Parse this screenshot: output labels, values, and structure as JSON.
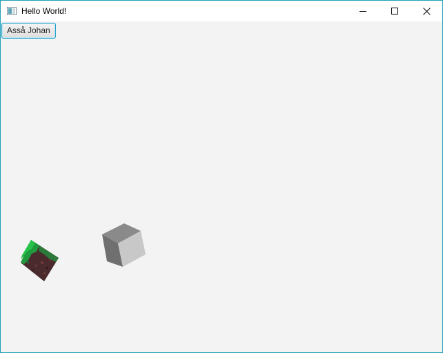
{
  "window": {
    "title": "Hello World!",
    "app_icon": "java-app-icon",
    "controls": {
      "minimize_icon": "minimize-icon",
      "maximize_icon": "maximize-icon",
      "close_icon": "close-icon"
    },
    "accent_color": "#1c9fb5"
  },
  "toolbar": {
    "button_label": "Asså Johan"
  },
  "scene": {
    "background_color": "#f3f3f3",
    "objects": [
      {
        "name": "grass-dirt-cube",
        "texture": "grass-dirt"
      },
      {
        "name": "gray-cube",
        "texture": "plain-gray"
      }
    ]
  }
}
